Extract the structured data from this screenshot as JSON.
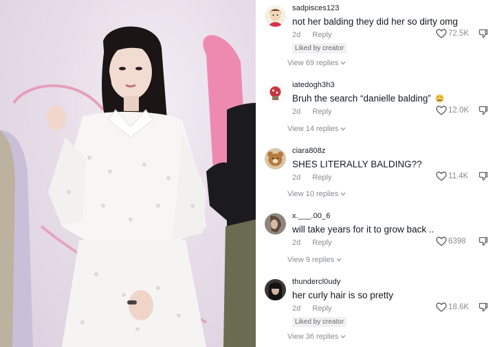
{
  "comments": [
    {
      "username": "sadpisces123",
      "text": "not her balding they did her so dirty omg",
      "date": "2d",
      "reply_label": "Reply",
      "likes": "72.5K",
      "liked_by_creator": "Liked by creator",
      "view_replies": "View 69 replies"
    },
    {
      "username": "iatedogh3h3",
      "text": "Bruh the search “danielle balding”",
      "date": "2d",
      "reply_label": "Reply",
      "likes": "12.0K",
      "view_replies": "View 14 replies"
    },
    {
      "username": "ciara808z",
      "text": "SHES LITERALLY BALDING??",
      "date": "2d",
      "reply_label": "Reply",
      "likes": "11.4K",
      "view_replies": "View 10 replies"
    },
    {
      "username": "x.___.00_6",
      "text": "will take years for it to grow back ..",
      "date": "2d",
      "reply_label": "Reply",
      "likes": "6398",
      "view_replies": "View 9 replies"
    },
    {
      "username": "thundercl0udy",
      "text": "her curly hair is so pretty",
      "date": "2d",
      "reply_label": "Reply",
      "likes": "18.6K",
      "liked_by_creator": "Liked by creator",
      "view_replies": "View 36 replies"
    }
  ],
  "icons": {
    "like": "heart-outline-icon",
    "dislike": "thumbs-down-icon",
    "expand": "chevron-down-icon",
    "emoji": "crying-face-emoji"
  },
  "colors": {
    "text": "#161823",
    "muted": "#8a8b91",
    "badge_bg": "#f1f1f2"
  }
}
